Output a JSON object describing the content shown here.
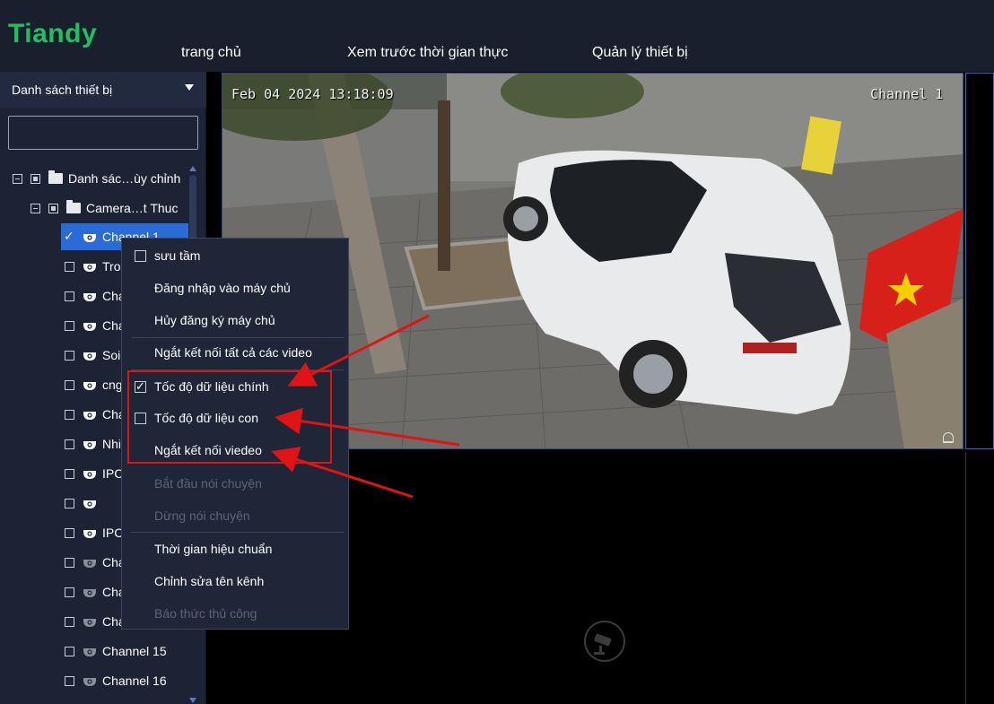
{
  "app": {
    "logo": "Tiandy"
  },
  "nav": {
    "home": "trang chủ",
    "live_preview": "Xem trước thời gian thực",
    "device_management": "Quản lý thiết bị"
  },
  "sidebar": {
    "title": "Danh sách thiết bị",
    "search_value": "",
    "tree": {
      "root_label": "Danh sác…ùy chỉnh",
      "group_label": "Camera…t Thuc",
      "channels": [
        {
          "label": "Channel 1",
          "checked": true,
          "selected": true
        },
        {
          "label": "Tron",
          "checked": false
        },
        {
          "label": "Cha",
          "checked": false
        },
        {
          "label": "Cha",
          "checked": false
        },
        {
          "label": "Soi",
          "checked": false
        },
        {
          "label": "cng",
          "checked": false
        },
        {
          "label": "Cha",
          "checked": false
        },
        {
          "label": "Nhin",
          "checked": false
        },
        {
          "label": "IPC",
          "checked": false
        },
        {
          "label": "",
          "checked": false
        },
        {
          "label": "IPC",
          "checked": false
        },
        {
          "label": "Cha",
          "checked": false
        },
        {
          "label": "Cha",
          "checked": false
        },
        {
          "label": "Cha",
          "checked": false
        },
        {
          "label": "Channel 15",
          "checked": false
        },
        {
          "label": "Channel 16",
          "checked": false
        }
      ]
    }
  },
  "video": {
    "osd_timestamp": "Feb 04 2024 13:18:09",
    "osd_channel": "Channel 1"
  },
  "context_menu": {
    "items": {
      "collect": "sưu tầm",
      "login_host": "Đăng nhập vào máy chủ",
      "logout_host": "Hủy đăng ký máy chủ",
      "disconnect_all": "Ngắt kết nối tất cả các video",
      "main_stream": "Tốc độ dữ liệu chính",
      "sub_stream": "Tốc độ dữ liệu con",
      "disconnect_video": "Ngắt kết nối viedeo",
      "start_talk": "Bắt đầu nói chuyện",
      "stop_talk": "Dừng nói chuyện",
      "calibrate_time": "Thời gian hiệu chuẩn",
      "edit_channel_name": "Chỉnh sửa tên kênh",
      "manual_alarm": "Báo thức thủ công"
    },
    "main_stream_checked": true,
    "sub_stream_checked": false,
    "collect_checked": false
  },
  "colors": {
    "logo_green": "#20c060",
    "selection_blue": "#2a6bd8",
    "annotation_red": "#e01414",
    "panel_bg": "#1b2335"
  }
}
